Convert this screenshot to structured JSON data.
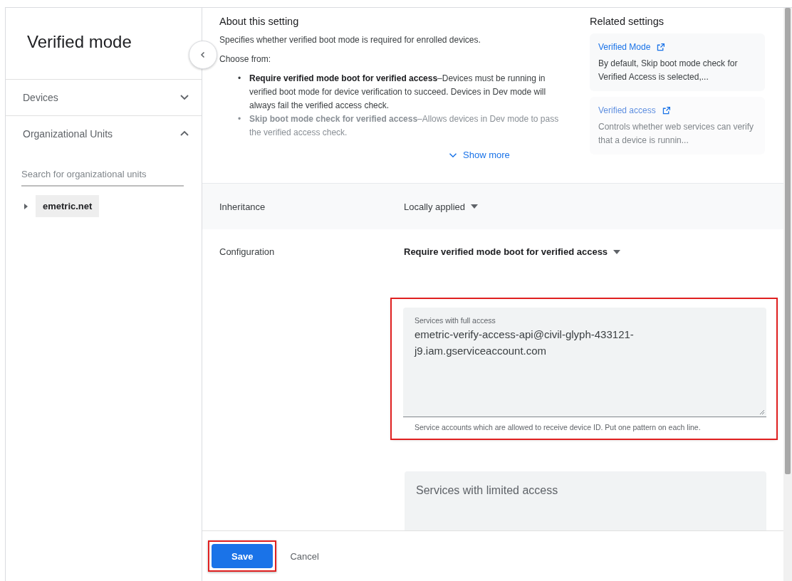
{
  "sidebar": {
    "title": "Verified mode",
    "sections": [
      {
        "label": "Devices",
        "expanded": false
      },
      {
        "label": "Organizational Units",
        "expanded": true
      }
    ],
    "search": {
      "placeholder": "Search for organizational units"
    },
    "tree": [
      {
        "label": "emetric.net",
        "expanded": false,
        "selected": true
      }
    ]
  },
  "about": {
    "heading": "About this setting",
    "intro": "Specifies whether verified boot mode is required for enrolled devices.",
    "choose": "Choose from:",
    "options": [
      {
        "bullet": "•",
        "text": "**Require verified mode boot for verified access**–Devices must be running in verified boot mode for device verification to succeed. Devices in Dev mode will always fail the verified access check.",
        "faded": false
      },
      {
        "bullet": "•",
        "text": "**Skip boot mode check for verified access**–Allows devices in Dev mode to pass the verified access check.",
        "faded": true
      }
    ],
    "show_more": "Show more"
  },
  "related": {
    "heading": "Related settings",
    "cards": [
      {
        "title": "Verified Mode",
        "description": "By default, Skip boot mode check for Verified Access is selected,...",
        "faded": false
      },
      {
        "title": "Verified access",
        "description": "Controls whether web services can verify that a device is runnin...",
        "faded": true
      }
    ]
  },
  "settings": [
    {
      "kind": "inheritance",
      "label": "Inheritance",
      "value": "Locally applied"
    },
    {
      "kind": "configuration",
      "label": "Configuration",
      "value": "Require verified mode boot for verified access"
    }
  ],
  "fields": [
    {
      "kind": "filled",
      "label": "Services with full access",
      "value": "emetric-verify-access-api@civil-glyph-433121-j9.iam.gserviceaccount.com",
      "helper": "Service accounts which are allowed to receive device ID. Put one pattern on each line.",
      "highlighted": true
    },
    {
      "kind": "empty",
      "placeholder": "Services with limited access",
      "highlighted": false
    }
  ],
  "footer": {
    "buttons": [
      {
        "label": "Save",
        "kind": "primary",
        "highlighted": true
      },
      {
        "label": "Cancel",
        "kind": "text",
        "highlighted": false
      }
    ]
  }
}
